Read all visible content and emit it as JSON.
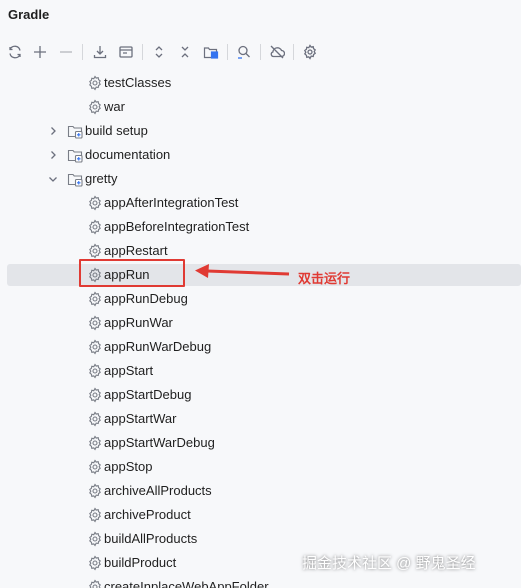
{
  "panel": {
    "title": "Gradle"
  },
  "toolbar": {
    "buttons": [
      {
        "name": "refresh-icon"
      },
      {
        "name": "plus-icon"
      },
      {
        "name": "minus-icon"
      },
      {
        "name": "download-icon"
      },
      {
        "name": "execute-task-icon"
      },
      {
        "name": "expand-all-icon"
      },
      {
        "name": "collapse-all-icon"
      },
      {
        "name": "group-modules-icon"
      },
      {
        "name": "analyze-dependencies-icon"
      },
      {
        "name": "offline-mode-icon"
      },
      {
        "name": "settings-icon"
      }
    ]
  },
  "tree": {
    "items": [
      {
        "label": "testClasses",
        "type": "task"
      },
      {
        "label": "war",
        "type": "task"
      },
      {
        "label": "build setup",
        "type": "folder",
        "expanded": false
      },
      {
        "label": "documentation",
        "type": "folder",
        "expanded": false
      },
      {
        "label": "gretty",
        "type": "folder",
        "expanded": true
      },
      {
        "label": "appAfterIntegrationTest",
        "type": "task"
      },
      {
        "label": "appBeforeIntegrationTest",
        "type": "task"
      },
      {
        "label": "appRestart",
        "type": "task"
      },
      {
        "label": "appRun",
        "type": "task",
        "selected": true
      },
      {
        "label": "appRunDebug",
        "type": "task"
      },
      {
        "label": "appRunWar",
        "type": "task"
      },
      {
        "label": "appRunWarDebug",
        "type": "task"
      },
      {
        "label": "appStart",
        "type": "task"
      },
      {
        "label": "appStartDebug",
        "type": "task"
      },
      {
        "label": "appStartWar",
        "type": "task"
      },
      {
        "label": "appStartWarDebug",
        "type": "task"
      },
      {
        "label": "appStop",
        "type": "task"
      },
      {
        "label": "archiveAllProducts",
        "type": "task"
      },
      {
        "label": "archiveProduct",
        "type": "task"
      },
      {
        "label": "buildAllProducts",
        "type": "task"
      },
      {
        "label": "buildProduct",
        "type": "task"
      },
      {
        "label": "createInplaceWebAppFolder",
        "type": "task"
      }
    ]
  },
  "annotation": {
    "text": "双击运行",
    "color": "#e03a33"
  },
  "watermark": {
    "text": "掘金技术社区 @ 野鬼圣经"
  }
}
